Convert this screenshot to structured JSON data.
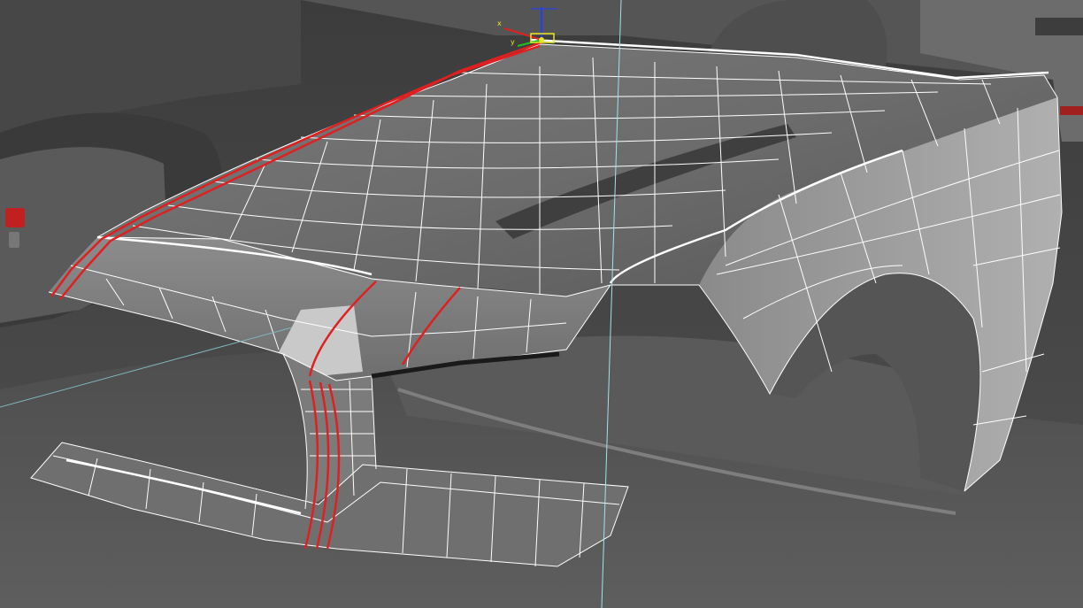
{
  "viewport": {
    "background": "#3a3a3a",
    "surface_dark": "#4b4b4b",
    "surface_mid": "#6a6a6a",
    "surface_light": "#9a9a9a",
    "wire_color": "#ffffff",
    "seam_color": "#e02020",
    "guide_color": "#9fe3ee"
  },
  "gizmo": {
    "x_label": "x",
    "y_label": "y",
    "x_color": "#e02020",
    "y_color": "#20c020",
    "z_color": "#2040ff",
    "pivot_color": "#e8e820"
  },
  "icons": [
    "transform-gizmo-icon",
    "seat-belt-buckle-icon"
  ]
}
